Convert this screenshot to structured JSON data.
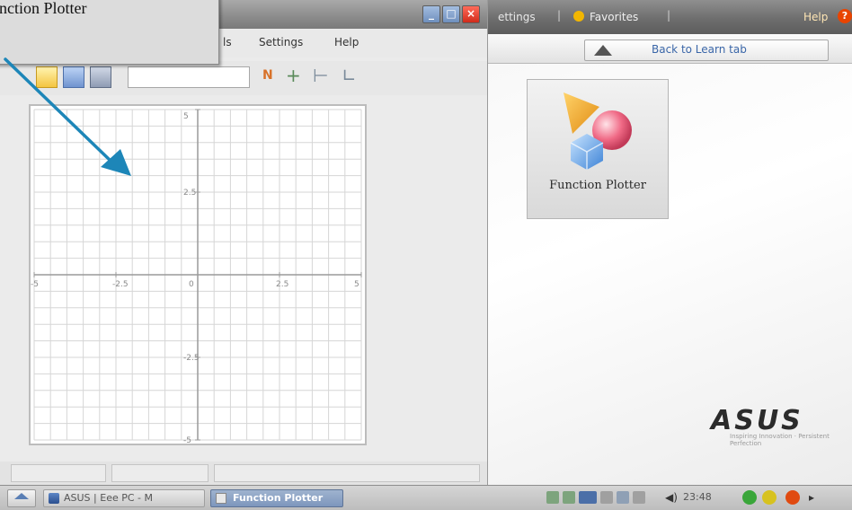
{
  "callout": {
    "text": "nction Plotter"
  },
  "launcher": {
    "topbar": {
      "settings": "ettings",
      "favorites": "Favorites",
      "help": "Help",
      "help_icon": "?"
    },
    "back_button": "Back to Learn tab",
    "app_tile": {
      "label": "Function Plotter"
    },
    "logo": {
      "wordmark": "ASUS",
      "tagline": "Inspiring Innovation · Persistent Perfection"
    }
  },
  "plotter": {
    "window_controls": {
      "minimize": "_",
      "maximize": "□",
      "close": "×"
    },
    "menu": {
      "tools": "ls",
      "settings": "Settings",
      "help": "Help"
    },
    "function_input": {
      "value": ""
    },
    "toolbar_glyphs": {
      "plot": "N",
      "add": "+",
      "trace": "⊢",
      "axes": "∟"
    },
    "chart_data": {
      "type": "line",
      "series": [],
      "xlim": [
        -5,
        5
      ],
      "ylim": [
        -5,
        5
      ],
      "x_ticks": [
        "-5",
        "-2.5",
        "2.5",
        "5"
      ],
      "y_ticks": [
        "5",
        "2.5",
        "-2.5",
        "-5"
      ],
      "origin_label": "0",
      "grid": true
    }
  },
  "taskbar": {
    "tasks": [
      {
        "label": "ASUS | Eee PC - M"
      },
      {
        "label": "Function Plotter"
      }
    ],
    "clock": "23:48",
    "volume_glyph": "◀)",
    "more_glyph": "▸"
  }
}
